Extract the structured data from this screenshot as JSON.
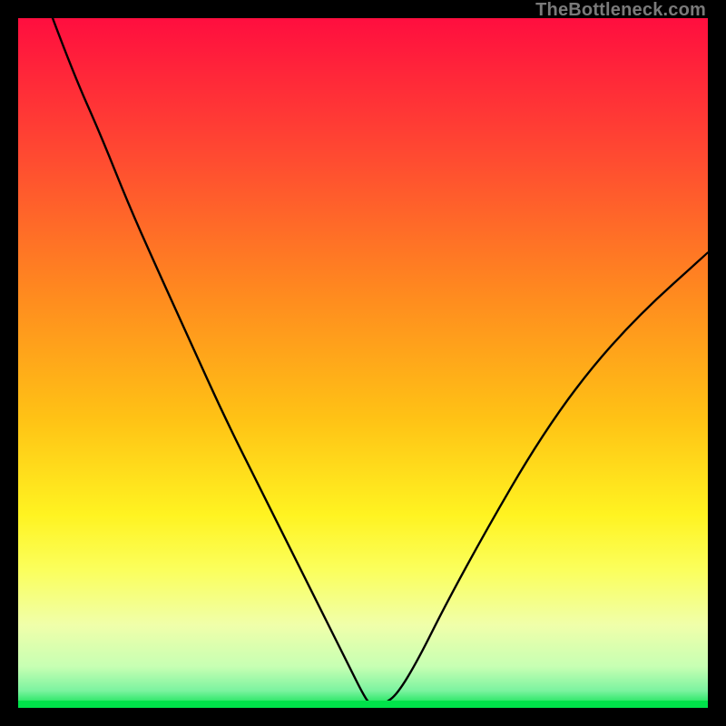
{
  "watermark": "TheBottleneck.com",
  "chart_data": {
    "type": "line",
    "title": "",
    "xlabel": "",
    "ylabel": "",
    "xlim": [
      0,
      100
    ],
    "ylim": [
      0,
      100
    ],
    "grid": false,
    "legend": false,
    "background_gradient": {
      "stops": [
        {
          "offset": 0.0,
          "color": "#ff0e3f"
        },
        {
          "offset": 0.2,
          "color": "#ff4a31"
        },
        {
          "offset": 0.4,
          "color": "#ff8a1f"
        },
        {
          "offset": 0.58,
          "color": "#ffc215"
        },
        {
          "offset": 0.72,
          "color": "#fff321"
        },
        {
          "offset": 0.8,
          "color": "#fbff5c"
        },
        {
          "offset": 0.88,
          "color": "#f0ffaa"
        },
        {
          "offset": 0.94,
          "color": "#c7ffb3"
        },
        {
          "offset": 0.975,
          "color": "#7cf3a0"
        },
        {
          "offset": 1.0,
          "color": "#00e24a"
        }
      ]
    },
    "series": [
      {
        "name": "bottleneck-curve",
        "color": "#000000",
        "width": 2.4,
        "x": [
          5,
          8,
          12,
          16,
          20,
          25,
          30,
          35,
          40,
          45,
          48,
          50,
          51,
          52,
          53,
          55,
          58,
          62,
          68,
          75,
          82,
          90,
          100
        ],
        "y": [
          100,
          92,
          83,
          73,
          64,
          53,
          42,
          32,
          22,
          12,
          6,
          2,
          0.5,
          0.4,
          0.5,
          2,
          7,
          15,
          26,
          38,
          48,
          57,
          66
        ]
      }
    ],
    "markers": [
      {
        "name": "optimum-point",
        "x": 52,
        "y": 0.4,
        "rx": 7,
        "ry": 5,
        "fill": "#c98374"
      }
    ]
  }
}
